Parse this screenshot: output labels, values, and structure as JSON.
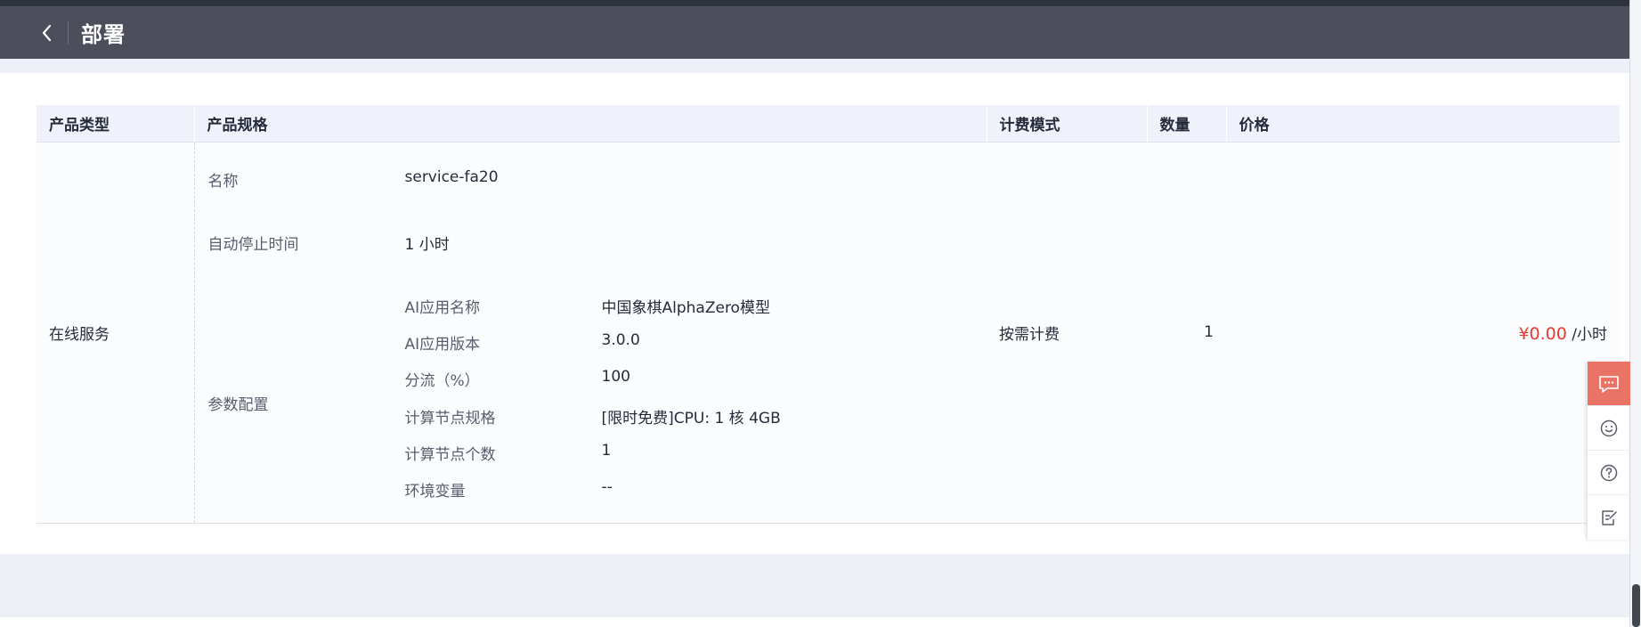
{
  "header": {
    "title": "部署",
    "back_icon": "chevron-left-icon"
  },
  "table": {
    "headers": {
      "type": "产品类型",
      "spec": "产品规格",
      "billing": "计费模式",
      "quantity": "数量",
      "price": "价格"
    },
    "row": {
      "type": "在线服务",
      "spec": {
        "name_label": "名称",
        "name_value": "service-fa20",
        "autostop_label": "自动停止时间",
        "autostop_value": "1 小时",
        "params_label": "参数配置",
        "params": [
          {
            "key": "AI应用名称",
            "value": "中国象棋AlphaZero模型"
          },
          {
            "key": "AI应用版本",
            "value": "3.0.0"
          },
          {
            "key": "分流（%）",
            "value": "100"
          },
          {
            "key": "计算节点规格",
            "value": "[限时免费]CPU: 1 核 4GB"
          },
          {
            "key": "计算节点个数",
            "value": "1"
          },
          {
            "key": "环境变量",
            "value": "--"
          }
        ]
      },
      "billing": "按需计费",
      "quantity": "1",
      "price_amount": "¥0.00",
      "price_unit": "/小时"
    }
  },
  "float_bar": {
    "items": [
      "chat-icon",
      "smile-icon",
      "help-icon",
      "feedback-icon"
    ],
    "active_color": "#e97465"
  },
  "colors": {
    "header_bg": "#4c4f5b",
    "table_header_bg": "#eff2fa",
    "price_red": "#e63b2e"
  }
}
